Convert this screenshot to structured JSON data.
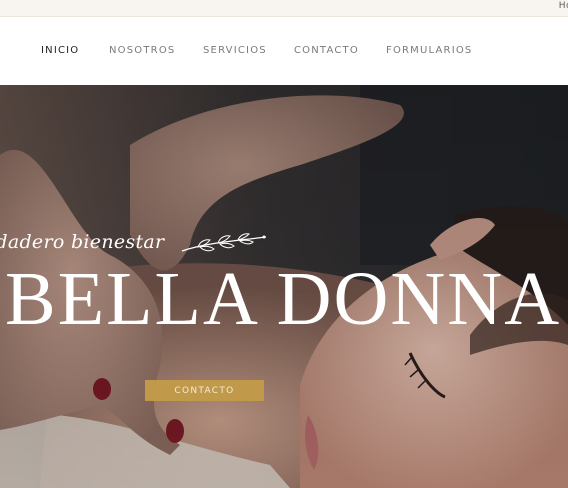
{
  "topbar": {
    "text": "Ho"
  },
  "nav": {
    "items": [
      {
        "label": "INICIO",
        "active": true
      },
      {
        "label": "NOSOTROS",
        "active": false
      },
      {
        "label": "SERVICIOS",
        "active": false
      },
      {
        "label": "CONTACTO",
        "active": false
      },
      {
        "label": "FORMULARIOS",
        "active": false
      }
    ]
  },
  "hero": {
    "tagline": "rdadero bienestar",
    "title": "BELLA DONNA",
    "button_label": "CONTACTO",
    "background": "massage-photo"
  },
  "colors": {
    "accent": "#c09a4a",
    "nav_text": "#777b80",
    "nav_active": "#1e1e24",
    "topbar_bg": "#f8f4ef"
  }
}
